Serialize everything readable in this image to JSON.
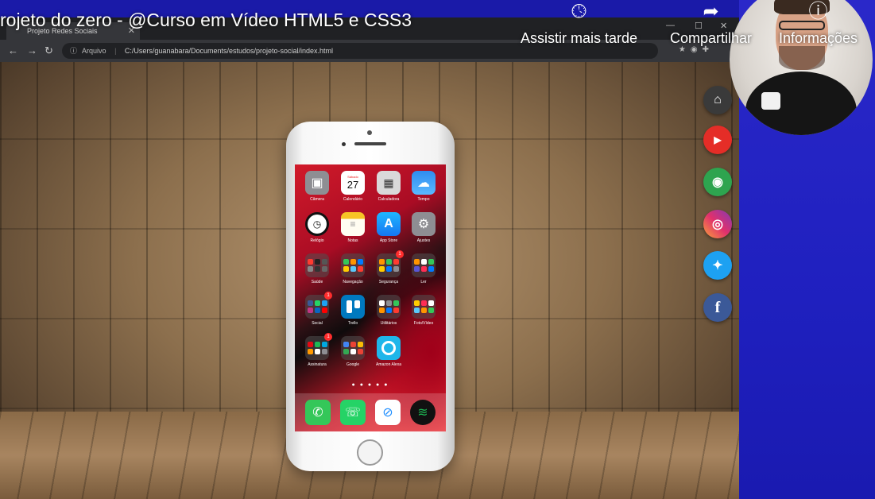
{
  "video": {
    "title": "rojeto do zero - @Curso em Vídeo HTML5 e CSS3",
    "actions": [
      {
        "label": "Assistir mais tarde",
        "icon": "clock-icon"
      },
      {
        "label": "Compartilhar",
        "icon": "share-icon"
      },
      {
        "label": "Informações",
        "icon": "info-icon"
      }
    ]
  },
  "browser": {
    "tab_title": "Projeto Redes Sociais",
    "address_info": "Arquivo",
    "address_url": "C:/Users/guanabara/Documents/estudos/projeto-social/index.html"
  },
  "phone": {
    "calendar_day": "27",
    "calendar_weekday": "Sábado",
    "page_dots": "● ● ● ● ●",
    "apps": [
      {
        "label": "Câmera",
        "icon": "camera-icon"
      },
      {
        "label": "Calendário",
        "icon": "calendar-icon"
      },
      {
        "label": "Calculadora",
        "icon": "calculator-icon"
      },
      {
        "label": "Tempo",
        "icon": "weather-icon"
      },
      {
        "label": "Relógio",
        "icon": "clock-icon"
      },
      {
        "label": "Notas",
        "icon": "notes-icon"
      },
      {
        "label": "App Store",
        "icon": "app-store-icon"
      },
      {
        "label": "Ajustes",
        "icon": "settings-icon"
      },
      {
        "label": "Saúde",
        "icon": "folder-icon"
      },
      {
        "label": "Navegação",
        "icon": "folder-icon"
      },
      {
        "label": "Segurança",
        "icon": "folder-icon",
        "badge": "1"
      },
      {
        "label": "Ler",
        "icon": "folder-icon"
      },
      {
        "label": "Social",
        "icon": "folder-icon",
        "badge": "1"
      },
      {
        "label": "Trello",
        "icon": "trello-icon"
      },
      {
        "label": "Utilitários",
        "icon": "folder-icon"
      },
      {
        "label": "Foto/Vídeo",
        "icon": "folder-icon"
      },
      {
        "label": "Assinatura",
        "icon": "folder-icon",
        "badge": "1"
      },
      {
        "label": "Google",
        "icon": "folder-icon"
      },
      {
        "label": "Amazon Alexa",
        "icon": "alexa-icon"
      }
    ],
    "dock": [
      {
        "icon": "phone-icon"
      },
      {
        "icon": "whatsapp-icon"
      },
      {
        "icon": "safari-icon"
      },
      {
        "icon": "spotify-icon"
      }
    ]
  },
  "social": [
    {
      "name": "home",
      "icon": "home-icon",
      "color": "#333333"
    },
    {
      "name": "youtube",
      "icon": "youtube-icon",
      "color": "#e52d27"
    },
    {
      "name": "github",
      "icon": "github-icon",
      "color": "#2ea44f"
    },
    {
      "name": "instagram",
      "icon": "instagram-icon",
      "color": "#c13584"
    },
    {
      "name": "twitter",
      "icon": "twitter-icon",
      "color": "#1da1f2"
    },
    {
      "name": "facebook",
      "icon": "facebook-icon",
      "color": "#3b5998"
    }
  ],
  "colors": {
    "side_panel": "#2222c0",
    "phone_wallpaper_red": "#d11a2a"
  }
}
